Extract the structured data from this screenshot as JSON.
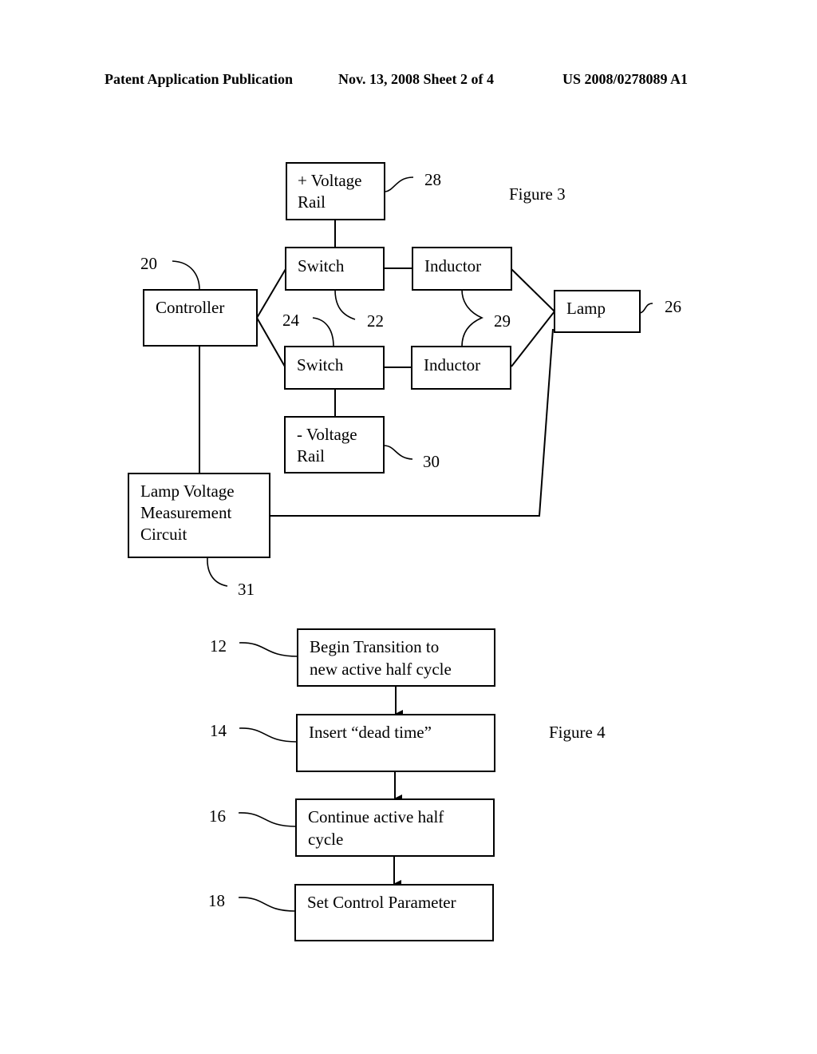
{
  "header": {
    "left": "Patent Application Publication",
    "center": "Nov. 13, 2008   Sheet 2 of 4",
    "right": "US 2008/0278089 A1"
  },
  "figure3": {
    "title": "Figure 3",
    "blocks": {
      "pos_rail": {
        "lines": [
          "+ Voltage",
          "Rail"
        ],
        "ref": "28"
      },
      "switch_top": {
        "lines": [
          "Switch"
        ],
        "ref": "22"
      },
      "switch_bottom": {
        "lines": [
          "Switch"
        ],
        "ref": "24"
      },
      "inductor_top": {
        "lines": [
          "Inductor"
        ]
      },
      "inductor_bottom": {
        "lines": [
          "Inductor"
        ]
      },
      "inductors_ref": "29",
      "controller": {
        "lines": [
          "Controller"
        ],
        "ref": "20"
      },
      "lamp": {
        "lines": [
          "Lamp"
        ],
        "ref": "26"
      },
      "neg_rail": {
        "lines": [
          "- Voltage",
          "Rail"
        ],
        "ref": "30"
      },
      "measurement": {
        "lines": [
          "Lamp Voltage",
          "Measurement",
          "Circuit"
        ],
        "ref": "31"
      }
    }
  },
  "figure4": {
    "title": "Figure 4",
    "steps": [
      {
        "ref": "12",
        "lines": [
          "Begin Transition to",
          "new active half cycle"
        ]
      },
      {
        "ref": "14",
        "lines": [
          "Insert “dead time”"
        ]
      },
      {
        "ref": "16",
        "lines": [
          "Continue active half",
          "cycle"
        ]
      },
      {
        "ref": "18",
        "lines": [
          "Set Control Parameter"
        ]
      }
    ]
  }
}
